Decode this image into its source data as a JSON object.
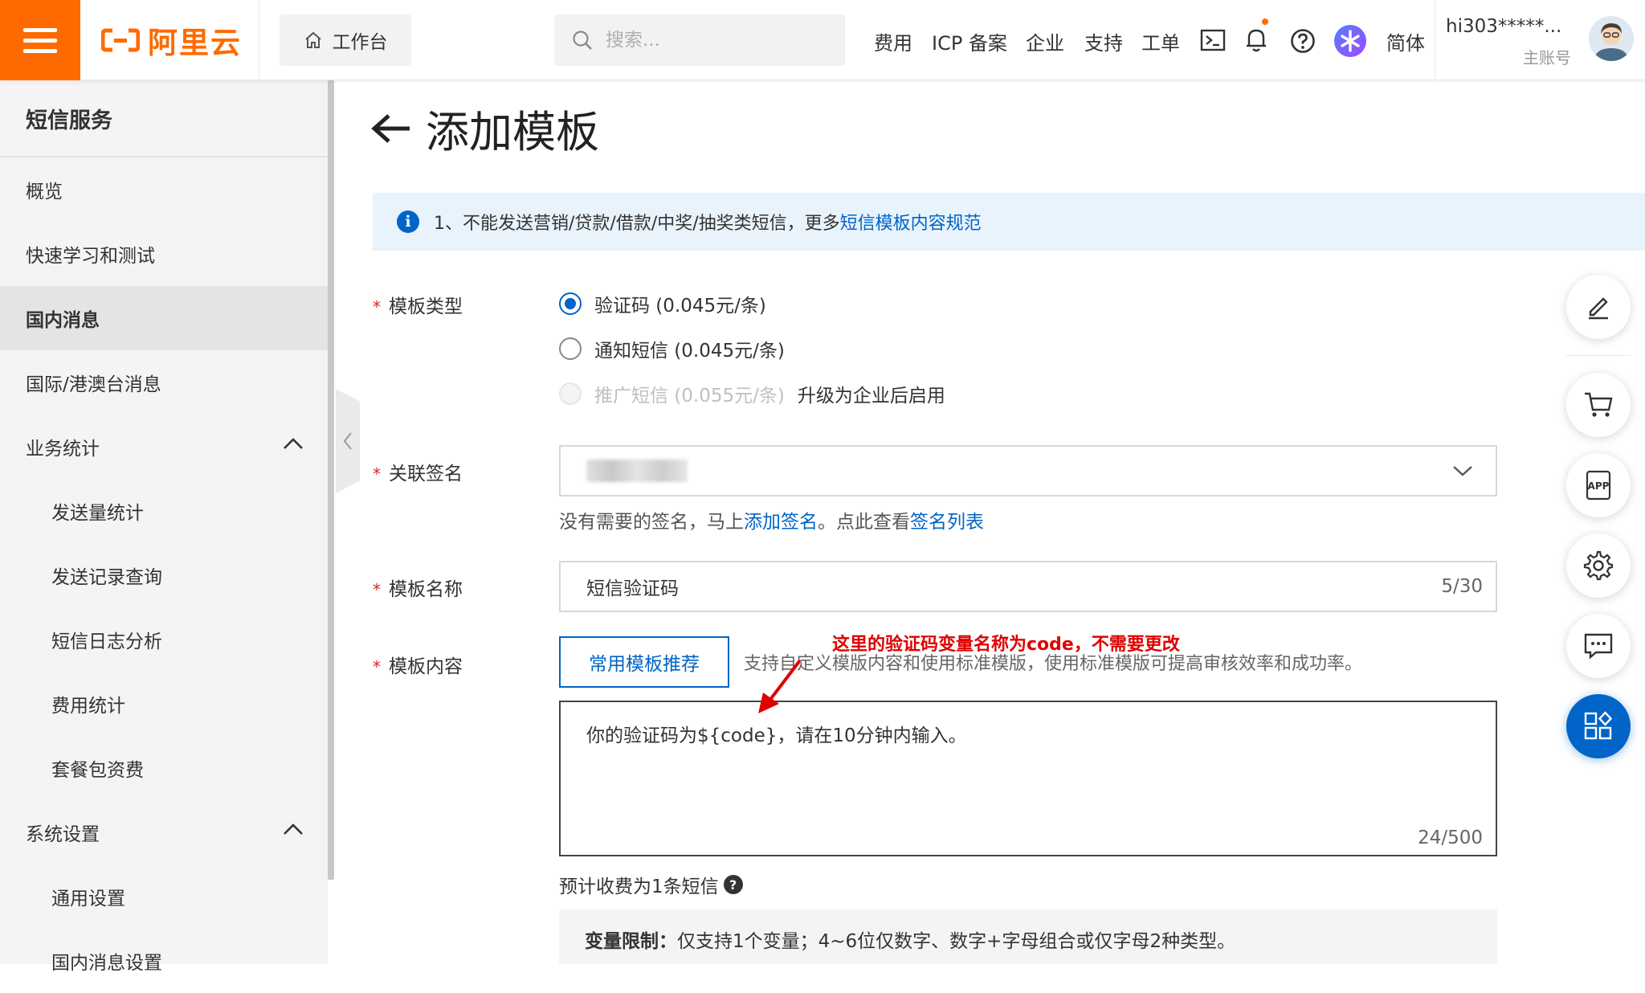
{
  "topbar": {
    "logo_text": "阿里云",
    "workbench_label": "工作台",
    "search_placeholder": "搜索...",
    "nav": [
      "费用",
      "ICP 备案",
      "企业",
      "支持",
      "工单"
    ],
    "language": "简体",
    "user_name": "hi303*****...",
    "user_sub": "主账号",
    "brand_color": "#ff6a00"
  },
  "sidebar": {
    "title": "短信服务",
    "items": [
      {
        "label": "概览"
      },
      {
        "label": "快速学习和测试"
      },
      {
        "label": "国内消息",
        "active": true
      },
      {
        "label": "国际/港澳台消息"
      },
      {
        "label": "业务统计",
        "expanded": true
      },
      {
        "label": "发送量统计"
      },
      {
        "label": "发送记录查询"
      },
      {
        "label": "短信日志分析"
      },
      {
        "label": "费用统计"
      },
      {
        "label": "套餐包资费"
      },
      {
        "label": "系统设置",
        "expanded": true
      },
      {
        "label": "通用设置"
      },
      {
        "label": "国内消息设置"
      }
    ]
  },
  "page": {
    "title": "添加模板",
    "notice_text": "1、不能发送营销/贷款/借款/中奖/抽奖类短信，更多",
    "notice_link": "短信模板内容规范"
  },
  "form": {
    "type_label": "模板类型",
    "types": [
      {
        "label": "验证码 (0.045元/条)",
        "selected": true
      },
      {
        "label": "通知短信 (0.045元/条)",
        "selected": false
      },
      {
        "label": "推广短信 (0.055元/条)",
        "disabled": true,
        "extra": "升级为企业后启用"
      }
    ],
    "signature_label": "关联签名",
    "signature_help_prefix": "没有需要的签名，马上",
    "signature_help_link1": "添加签名",
    "signature_help_mid": "。点此查看",
    "signature_help_link2": "签名列表",
    "name_label": "模板名称",
    "name_value": "短信验证码",
    "name_counter": "5/30",
    "content_label": "模板内容",
    "recommend_button": "常用模板推荐",
    "content_hint": "支持自定义模版内容和使用标准模版，使用标准模版可提高审核效率和成功率。",
    "content_value": "你的验证码为${code}，请在10分钟内输入。",
    "content_counter": "24/500",
    "fee_note": "预计收费为1条短信",
    "var_limit_title": "变量限制：",
    "var_limit_text": "仅支持1个变量；4~6位仅数字、数字+字母组合或仅字母2种类型。"
  },
  "annotation": {
    "text": "这里的验证码变量名称为code，不需要更改",
    "color": "#e00000"
  },
  "accent_color": "#0064c8"
}
